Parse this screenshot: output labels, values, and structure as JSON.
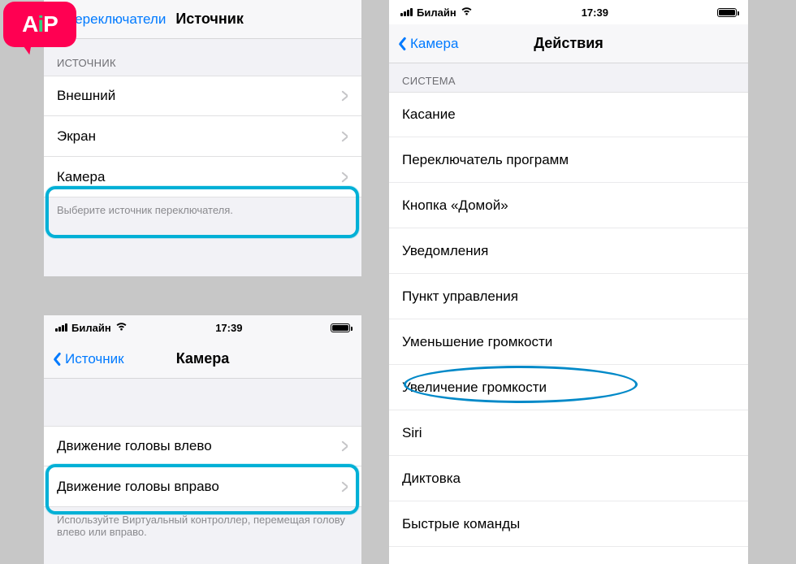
{
  "carrier": "Билайн",
  "time": "17:39",
  "panelA": {
    "back": "Переключатели",
    "title": "Источник",
    "section": "ИСТОЧНИК",
    "rows": [
      "Внешний",
      "Экран",
      "Камера"
    ],
    "footer": "Выберите источник переключателя."
  },
  "panelB": {
    "back": "Источник",
    "title": "Камера",
    "rows": [
      "Движение головы влево",
      "Движение головы вправо"
    ],
    "footer": "Используйте Виртуальный контроллер, перемещая голову влево или вправо."
  },
  "panelC": {
    "back": "Камера",
    "title": "Действия",
    "section": "СИСТЕМА",
    "rows": [
      "Касание",
      "Переключатель программ",
      "Кнопка «Домой»",
      "Уведомления",
      "Пункт управления",
      "Уменьшение громкости",
      "Увеличение громкости",
      "Siri",
      "Диктовка",
      "Быстрые команды"
    ]
  },
  "logo": {
    "a": "A",
    "i": "i",
    "p": "P"
  }
}
